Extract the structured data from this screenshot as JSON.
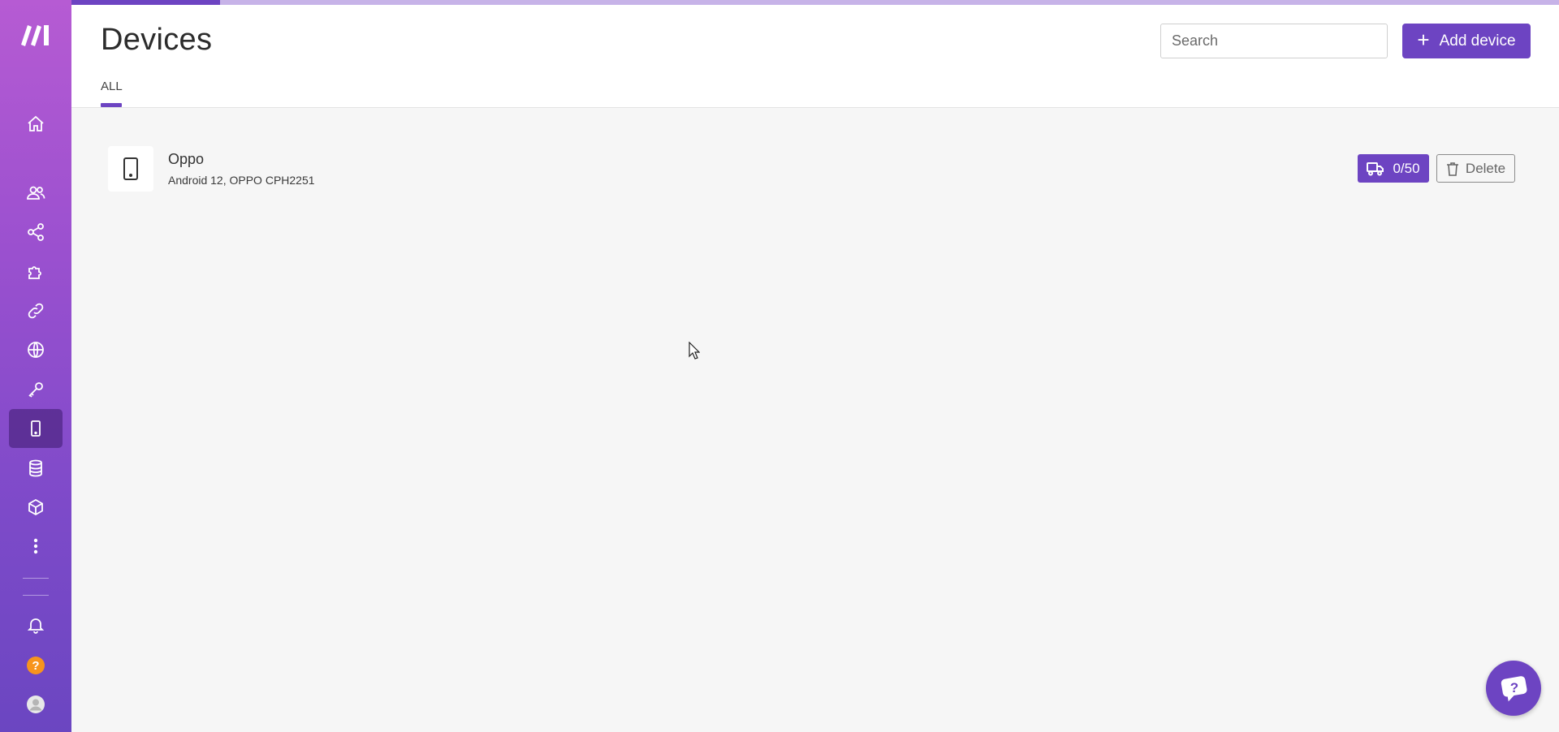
{
  "progress": {
    "fraction": 0.1
  },
  "header": {
    "title": "Devices",
    "tabs": [
      {
        "label": "ALL",
        "active": true
      }
    ],
    "search": {
      "placeholder": "Search",
      "value": ""
    },
    "add_button": {
      "label": "Add device"
    }
  },
  "sidebar": {
    "logo": "make-logo",
    "items": [
      {
        "name": "home",
        "icon": "home-icon"
      },
      {
        "name": "team",
        "icon": "users-icon"
      },
      {
        "name": "scenarios",
        "icon": "share-icon"
      },
      {
        "name": "templates",
        "icon": "puzzle-icon"
      },
      {
        "name": "connections",
        "icon": "link-icon"
      },
      {
        "name": "webhooks",
        "icon": "globe-icon"
      },
      {
        "name": "keys",
        "icon": "key-icon"
      },
      {
        "name": "devices",
        "icon": "mobile-icon",
        "active": true
      },
      {
        "name": "data-stores",
        "icon": "database-icon"
      },
      {
        "name": "data-structures",
        "icon": "cube-icon"
      },
      {
        "name": "more",
        "icon": "more-vertical-icon"
      },
      {
        "name": "notifications",
        "icon": "bell-icon"
      },
      {
        "name": "help",
        "icon": "help-icon"
      },
      {
        "name": "profile",
        "icon": "avatar-icon"
      }
    ]
  },
  "devices": [
    {
      "name": "Oppo",
      "description": "Android 12, OPPO CPH2251",
      "quota": "0/50",
      "delete_label": "Delete"
    }
  ],
  "colors": {
    "accent": "#6d44c2",
    "sidebar_top": "#b65bd3",
    "sidebar_bottom": "#6b46c1",
    "help_orange": "#f7941d"
  }
}
